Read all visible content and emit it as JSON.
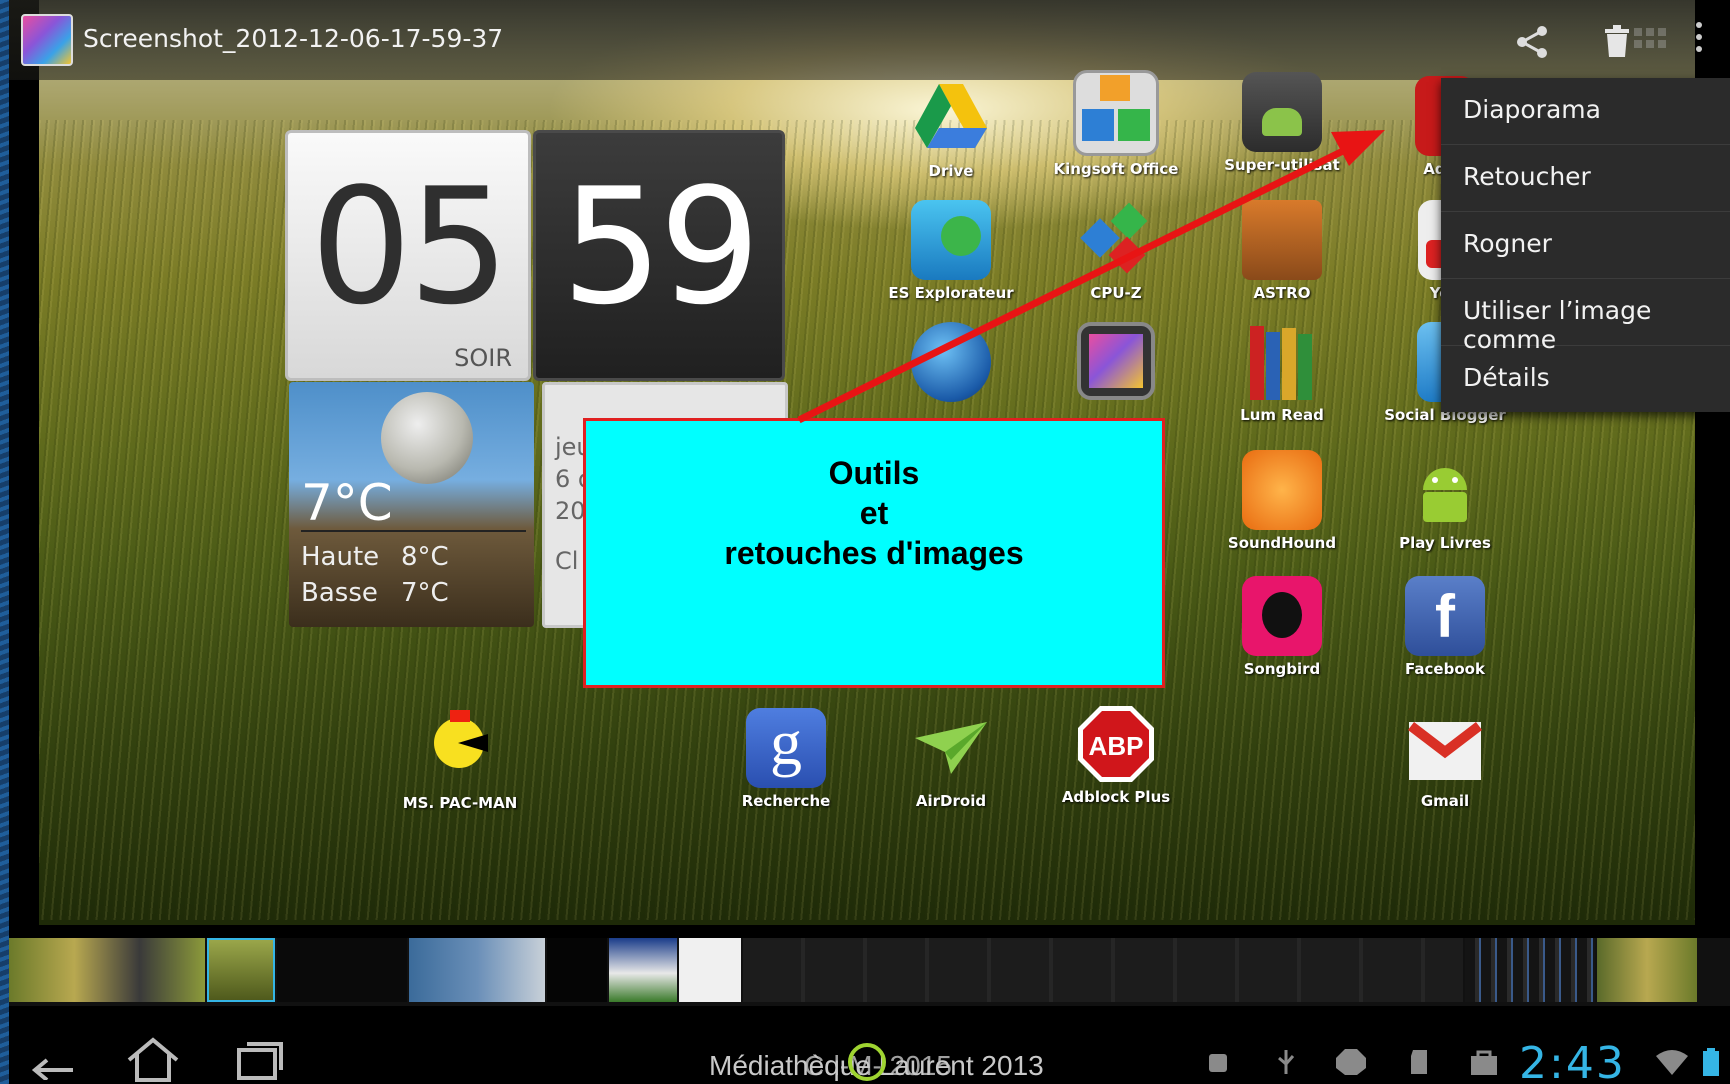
{
  "action_bar": {
    "file_title": "Screenshot_2012-12-06-17-59-37",
    "icons": [
      "app-thumbnail-icon",
      "share-icon",
      "trash-icon",
      "overflow-menu-icon"
    ]
  },
  "menu": {
    "items": [
      {
        "label": "Diaporama"
      },
      {
        "label": "Retoucher"
      },
      {
        "label": "Rogner"
      },
      {
        "label": "Utiliser l’image comme"
      },
      {
        "label": "Détails"
      }
    ]
  },
  "clock": {
    "hours": "05",
    "minutes": "59",
    "period": "SOIR"
  },
  "weather": {
    "temp_now": "7°C",
    "high_label": "Haute",
    "high_value": "8°C",
    "low_label": "Basse",
    "low_value": "7°C"
  },
  "calendar": {
    "line1": "jeu",
    "line2": "6 d",
    "line3": "20",
    "line4": "Cl"
  },
  "apps": [
    {
      "label": "Drive",
      "icon": "drive-icon"
    },
    {
      "label": "Kingsoft Office",
      "icon": "office-icon"
    },
    {
      "label": "Super-utilisat",
      "icon": "superuser-icon"
    },
    {
      "label": "Adob",
      "icon": "adobe-reader-icon"
    },
    {
      "label": "ES Explorateur",
      "icon": "es-explorer-icon"
    },
    {
      "label": "CPU-Z",
      "icon": "cubes-icon"
    },
    {
      "label": "ASTRO",
      "icon": "astro-icon"
    },
    {
      "label": "You",
      "icon": "youtube-icon"
    },
    {
      "label": "",
      "icon": "globe-icon"
    },
    {
      "label": "",
      "icon": "gallery-icon"
    },
    {
      "label": "Lum Read",
      "icon": "books-icon"
    },
    {
      "label": "Social Blogger",
      "icon": "blogger-icon"
    },
    {
      "label": "SoundHound",
      "icon": "soundhound-icon"
    },
    {
      "label": "Play Livres",
      "icon": "play-books-icon"
    },
    {
      "label": "Songbird",
      "icon": "songbird-icon"
    },
    {
      "label": "Facebook",
      "icon": "facebook-icon"
    },
    {
      "label": "MS. PAC-MAN",
      "icon": "pacman-icon"
    },
    {
      "label": "Recherche",
      "icon": "google-search-icon"
    },
    {
      "label": "AirDroid",
      "icon": "airdroid-icon"
    },
    {
      "label": "Adblock Plus",
      "icon": "adblock-icon"
    },
    {
      "label": "Gmail",
      "icon": "gmail-icon"
    }
  ],
  "callout": {
    "line1": "Outils",
    "line2": "et",
    "line3": "retouches d'images"
  },
  "footer": {
    "text": "Médiathèque Laurent 2013",
    "text_overlap": "Cd-M- 2015"
  },
  "status": {
    "time": "2:43"
  },
  "colors": {
    "accent_blue": "#35b5e5",
    "callout_bg": "#00ffff",
    "callout_border": "#e02020",
    "arrow": "#e81414"
  }
}
